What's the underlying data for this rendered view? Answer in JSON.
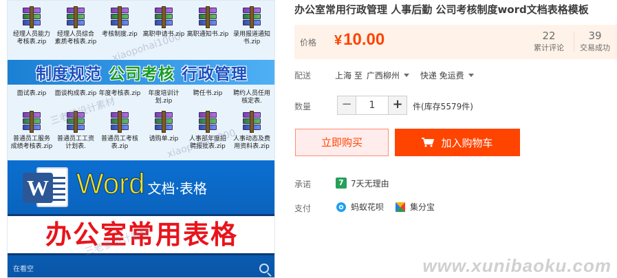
{
  "gallery": {
    "files_row1": [
      "经理人员能力考核表.zip",
      "经理人员综合素质考核表.zip",
      "考核制度.zip",
      "离职申请书.zip",
      "离职通知书.zip",
      "录用报道通知书.zip"
    ],
    "files_row2": [
      "面试表.zip",
      "面谈构成表.zip",
      "年度考核表.zip",
      "年度培训计划.zip",
      "聘任书.zip",
      "聘约人员任用核定表."
    ],
    "files_row3": [
      "普通员工服务成绩考核表.zip",
      "普通员工工资计划表.",
      "普通员工考核表.zip",
      "请购单.zip",
      "人事部年度招聘报批表.zip",
      "人事动态及费用资料表.zip"
    ],
    "banner_words": [
      "制度规范",
      "公司考核",
      "行政管理"
    ],
    "word_big": "Word",
    "word_small": "文档·表格",
    "office_title": "办公室常用表格",
    "zoom_hint": "在看空",
    "watermarks": [
      "xiaopohai1000",
      "三老爹设计素材",
      "xiaopohai1000",
      "三老爹设计素材"
    ]
  },
  "product": {
    "title": "办公室常用行政管理 人事后勤 公司考核制度word文档表格模板",
    "price_label": "价格",
    "currency": "¥",
    "price": "10.00",
    "reviews_count": "22",
    "reviews_label": "累计评论",
    "sales_count": "39",
    "sales_label": "交易成功"
  },
  "shipping": {
    "label": "配送",
    "from": "上海 至",
    "to": "广西柳州",
    "method": "快递 免运费"
  },
  "quantity": {
    "label": "数量",
    "minus": "−",
    "value": "1",
    "plus": "+",
    "stock": "件(库存5579件)"
  },
  "actions": {
    "buy_now": "立即购买",
    "add_to_cart": "加入购物车"
  },
  "promise": {
    "label": "承诺",
    "badge": "7",
    "text": "7天无理由"
  },
  "payment": {
    "label": "支付",
    "methods": [
      "蚂蚁花呗",
      "集分宝"
    ]
  },
  "site_watermark": "www.xunibaoku.com",
  "colors": {
    "accent": "#ff4400",
    "price_bg": "#fff2e8",
    "buy_now_bg": "#ffeded"
  }
}
